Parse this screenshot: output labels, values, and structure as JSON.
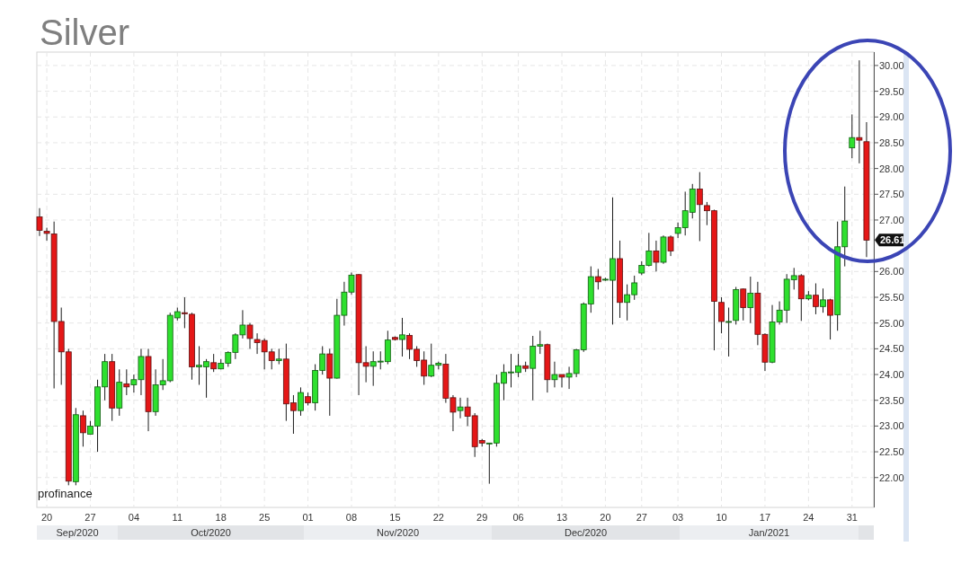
{
  "title": "Silver",
  "source_label": "profinance",
  "chart_data": {
    "type": "candlestick",
    "ylim": [
      21.42,
      30.26
    ],
    "categories": [
      null,
      "20",
      null,
      null,
      null,
      null,
      null,
      "27",
      null,
      null,
      null,
      null,
      null,
      "04",
      null,
      null,
      null,
      null,
      null,
      "11",
      null,
      null,
      null,
      null,
      null,
      "18",
      null,
      null,
      null,
      null,
      null,
      "25",
      null,
      null,
      null,
      null,
      null,
      "01",
      null,
      null,
      null,
      null,
      null,
      "08",
      null,
      null,
      null,
      null,
      null,
      "15",
      null,
      null,
      null,
      null,
      null,
      "22",
      null,
      null,
      null,
      null,
      null,
      "29",
      null,
      null,
      null,
      null,
      "06",
      null,
      null,
      null,
      null,
      null,
      "13",
      null,
      null,
      null,
      null,
      null,
      "20",
      null,
      null,
      null,
      null,
      "27",
      null,
      null,
      null,
      null,
      "03",
      null,
      null,
      null,
      null,
      null,
      "10",
      null,
      null,
      null,
      null,
      null,
      "17",
      null,
      null,
      null,
      null,
      null,
      "24",
      null,
      null,
      null,
      null,
      null,
      "31",
      null,
      null
    ],
    "yticks": [
      {
        "value": 22,
        "label": "22.00"
      },
      {
        "value": 22.5,
        "label": "22.50"
      },
      {
        "value": 23,
        "label": "23.00"
      },
      {
        "value": 23.5,
        "label": "23.50"
      },
      {
        "value": 24,
        "label": "24.00"
      },
      {
        "value": 24.5,
        "label": "24.50"
      },
      {
        "value": 25,
        "label": "25.00"
      },
      {
        "value": 25.5,
        "label": "25.50"
      },
      {
        "value": 26,
        "label": "26.00"
      },
      {
        "value": 27,
        "label": "27.00"
      },
      {
        "value": 27.5,
        "label": "27.50"
      },
      {
        "value": 28,
        "label": "28.00"
      },
      {
        "value": 28.5,
        "label": "28.50"
      },
      {
        "value": 29,
        "label": "29.00"
      },
      {
        "value": 29.5,
        "label": "29.50"
      },
      {
        "value": 30,
        "label": "30.00"
      }
    ],
    "ohlc": [
      [
        27.06,
        27.23,
        26.69,
        26.8
      ],
      [
        26.78,
        26.85,
        26.6,
        26.74
      ],
      [
        26.73,
        26.97,
        23.73,
        25.03
      ],
      [
        25.03,
        25.3,
        23.8,
        24.44
      ],
      [
        24.44,
        24.5,
        21.85,
        21.93
      ],
      [
        21.92,
        23.35,
        21.85,
        23.22
      ],
      [
        23.2,
        23.3,
        22.6,
        22.87
      ],
      [
        22.84,
        23.1,
        22.84,
        23.0
      ],
      [
        23.0,
        23.9,
        22.5,
        23.76
      ],
      [
        23.76,
        24.4,
        23.5,
        24.25
      ],
      [
        24.25,
        24.4,
        23.1,
        23.35
      ],
      [
        23.35,
        24.1,
        23.2,
        23.85
      ],
      [
        23.82,
        24.1,
        23.6,
        23.76
      ],
      [
        23.8,
        24.0,
        23.65,
        23.9
      ],
      [
        23.9,
        24.5,
        23.6,
        24.35
      ],
      [
        24.35,
        24.5,
        22.9,
        23.28
      ],
      [
        23.28,
        24.1,
        23.2,
        23.8
      ],
      [
        23.8,
        24.3,
        23.7,
        23.88
      ],
      [
        23.88,
        25.2,
        23.85,
        25.15
      ],
      [
        25.1,
        25.3,
        25.05,
        25.22
      ],
      [
        25.2,
        25.5,
        24.9,
        25.18
      ],
      [
        25.17,
        25.2,
        23.9,
        24.15
      ],
      [
        24.15,
        24.55,
        23.8,
        24.18
      ],
      [
        24.15,
        24.3,
        23.55,
        24.25
      ],
      [
        24.23,
        24.4,
        24.05,
        24.11
      ],
      [
        24.11,
        24.3,
        24.1,
        24.22
      ],
      [
        24.22,
        24.45,
        24.15,
        24.43
      ],
      [
        24.43,
        24.8,
        24.3,
        24.77
      ],
      [
        24.77,
        25.25,
        24.7,
        24.96
      ],
      [
        24.96,
        25.0,
        24.5,
        24.7
      ],
      [
        24.68,
        24.8,
        24.4,
        24.62
      ],
      [
        24.66,
        24.7,
        24.1,
        24.44
      ],
      [
        24.44,
        24.5,
        24.1,
        24.27
      ],
      [
        24.27,
        24.5,
        24.2,
        24.3
      ],
      [
        24.3,
        24.6,
        23.1,
        23.43
      ],
      [
        23.45,
        23.6,
        22.85,
        23.3
      ],
      [
        23.3,
        23.75,
        23.2,
        23.65
      ],
      [
        23.57,
        23.65,
        23.4,
        23.45
      ],
      [
        23.45,
        24.2,
        23.3,
        24.08
      ],
      [
        24.08,
        24.55,
        24.0,
        24.4
      ],
      [
        24.4,
        24.5,
        23.2,
        23.93
      ],
      [
        23.93,
        25.47,
        23.92,
        25.15
      ],
      [
        25.15,
        25.8,
        24.95,
        25.6
      ],
      [
        25.6,
        25.98,
        25.55,
        25.93
      ],
      [
        25.94,
        25.95,
        23.6,
        24.23
      ],
      [
        24.23,
        24.55,
        23.85,
        24.16
      ],
      [
        24.16,
        24.45,
        23.78,
        24.25
      ],
      [
        24.26,
        24.45,
        24.1,
        24.26
      ],
      [
        24.25,
        24.85,
        24.2,
        24.67
      ],
      [
        24.72,
        24.74,
        24.66,
        24.68
      ],
      [
        24.68,
        25.1,
        24.35,
        24.77
      ],
      [
        24.76,
        24.8,
        24.3,
        24.49
      ],
      [
        24.49,
        24.55,
        24.15,
        24.27
      ],
      [
        24.28,
        24.45,
        23.8,
        23.97
      ],
      [
        23.97,
        24.6,
        23.95,
        24.18
      ],
      [
        24.18,
        24.25,
        24.1,
        24.22
      ],
      [
        24.2,
        24.4,
        23.45,
        23.54
      ],
      [
        23.55,
        23.6,
        22.9,
        23.27
      ],
      [
        23.3,
        23.55,
        23.15,
        23.37
      ],
      [
        23.37,
        23.55,
        23.0,
        23.19
      ],
      [
        23.2,
        23.25,
        22.4,
        22.6
      ],
      [
        22.72,
        22.75,
        22.6,
        22.67
      ],
      [
        22.67,
        22.67,
        21.88,
        22.67
      ],
      [
        22.67,
        24.0,
        22.6,
        23.83
      ],
      [
        23.83,
        24.2,
        23.5,
        24.04
      ],
      [
        24.05,
        24.4,
        23.75,
        24.05
      ],
      [
        24.04,
        24.4,
        23.95,
        24.17
      ],
      [
        24.17,
        24.25,
        24.05,
        24.12
      ],
      [
        24.12,
        24.75,
        23.5,
        24.55
      ],
      [
        24.55,
        24.85,
        24.4,
        24.58
      ],
      [
        24.58,
        24.6,
        23.65,
        23.9
      ],
      [
        23.9,
        24.25,
        23.75,
        24.0
      ],
      [
        24.0,
        24.0,
        23.75,
        23.95
      ],
      [
        23.95,
        24.15,
        23.72,
        24.02
      ],
      [
        24.02,
        24.5,
        23.95,
        24.48
      ],
      [
        24.48,
        25.4,
        24.44,
        25.37
      ],
      [
        25.37,
        26.1,
        25.2,
        25.9
      ],
      [
        25.9,
        26.05,
        25.65,
        25.8
      ],
      [
        25.85,
        25.88,
        25.82,
        25.85
      ],
      [
        25.83,
        27.44,
        24.97,
        26.25
      ],
      [
        26.25,
        26.6,
        25.1,
        25.4
      ],
      [
        25.4,
        25.75,
        25.05,
        25.55
      ],
      [
        25.55,
        25.92,
        25.45,
        25.78
      ],
      [
        25.97,
        26.2,
        25.93,
        26.12
      ],
      [
        26.12,
        26.75,
        26.1,
        26.4
      ],
      [
        26.4,
        26.6,
        26.0,
        26.18
      ],
      [
        26.18,
        26.7,
        26.15,
        26.67
      ],
      [
        26.67,
        26.7,
        26.3,
        26.4
      ],
      [
        26.74,
        26.95,
        26.65,
        26.85
      ],
      [
        26.85,
        27.55,
        26.7,
        27.18
      ],
      [
        27.15,
        27.7,
        27.03,
        27.6
      ],
      [
        27.6,
        27.93,
        26.59,
        27.3
      ],
      [
        27.28,
        27.35,
        26.9,
        27.18
      ],
      [
        27.18,
        27.2,
        24.47,
        25.42
      ],
      [
        25.4,
        25.5,
        24.8,
        25.03
      ],
      [
        25.03,
        25.3,
        24.35,
        25.03
      ],
      [
        25.05,
        25.7,
        24.97,
        25.65
      ],
      [
        25.66,
        25.67,
        25.05,
        25.3
      ],
      [
        25.3,
        25.9,
        25.0,
        25.58
      ],
      [
        25.58,
        25.8,
        24.57,
        24.78
      ],
      [
        24.78,
        24.8,
        24.07,
        24.24
      ],
      [
        24.24,
        25.35,
        24.22,
        25.02
      ],
      [
        25.02,
        25.42,
        24.97,
        25.25
      ],
      [
        25.25,
        25.95,
        25.0,
        25.85
      ],
      [
        25.84,
        26.07,
        25.65,
        25.92
      ],
      [
        25.92,
        25.95,
        25.04,
        25.47
      ],
      [
        25.47,
        25.62,
        25.44,
        25.54
      ],
      [
        25.54,
        25.77,
        25.17,
        25.32
      ],
      [
        25.32,
        25.67,
        25.2,
        25.45
      ],
      [
        25.45,
        25.47,
        24.68,
        25.15
      ],
      [
        25.16,
        26.97,
        24.85,
        26.48
      ],
      [
        26.48,
        27.65,
        26.1,
        26.98
      ],
      [
        28.4,
        29.05,
        28.2,
        28.6
      ],
      [
        28.6,
        30.1,
        28.1,
        28.55
      ],
      [
        28.52,
        28.9,
        26.28,
        26.61
      ]
    ],
    "grid": true,
    "annotations": [
      "26.61"
    ]
  },
  "month_row": [
    "Sep/2020",
    "Oct/2020",
    "Nov/2020",
    "Dec/2020",
    "Jan/2021"
  ]
}
